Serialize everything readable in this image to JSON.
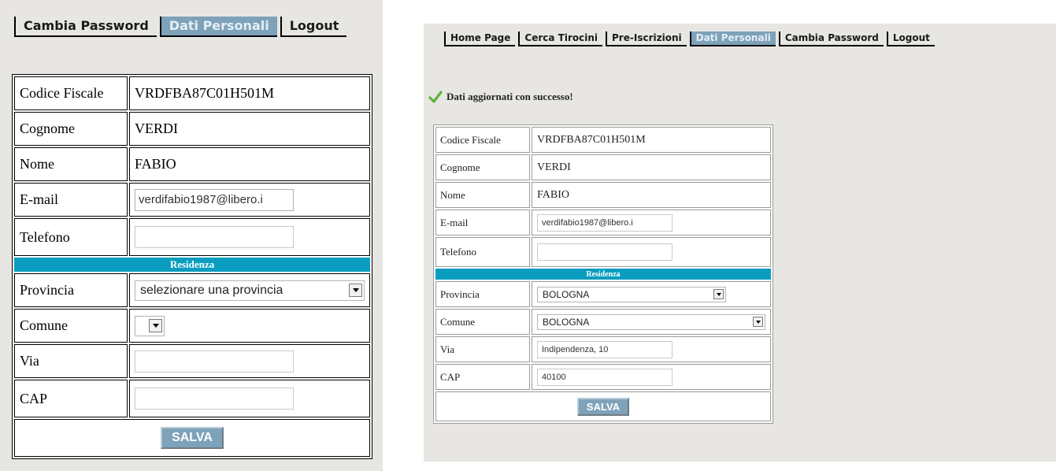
{
  "left": {
    "nav": [
      "Cambia Password",
      "Dati Personali",
      "Logout"
    ],
    "fields": {
      "codice_fiscale": {
        "label": "Codice Fiscale",
        "value": "VRDFBA87C01H501M"
      },
      "cognome": {
        "label": "Cognome",
        "value": "VERDI"
      },
      "nome": {
        "label": "Nome",
        "value": "FABIO"
      },
      "email": {
        "label": "E-mail",
        "value": "verdifabio1987@libero.i"
      },
      "telefono": {
        "label": "Telefono",
        "value": ""
      },
      "section": "Residenza",
      "provincia": {
        "label": "Provincia",
        "value": "selezionare una provincia"
      },
      "comune": {
        "label": "Comune",
        "value": ""
      },
      "via": {
        "label": "Via",
        "value": ""
      },
      "cap": {
        "label": "CAP",
        "value": ""
      }
    },
    "save_label": "SALVA"
  },
  "right": {
    "nav": [
      "Home Page",
      "Cerca Tirocini",
      "Pre-Iscrizioni",
      "Dati Personali",
      "Cambia Password",
      "Logout"
    ],
    "message": "Dati aggiornati con successo!",
    "fields": {
      "codice_fiscale": {
        "label": "Codice Fiscale",
        "value": "VRDFBA87C01H501M"
      },
      "cognome": {
        "label": "Cognome",
        "value": "VERDI"
      },
      "nome": {
        "label": "Nome",
        "value": "FABIO"
      },
      "email": {
        "label": "E-mail",
        "value": "verdifabio1987@libero.i"
      },
      "telefono": {
        "label": "Telefono",
        "value": ""
      },
      "section": "Residenza",
      "provincia": {
        "label": "Provincia",
        "value": "BOLOGNA"
      },
      "comune": {
        "label": "Comune",
        "value": "BOLOGNA"
      },
      "via": {
        "label": "Via",
        "value": "Indipendenza, 10"
      },
      "cap": {
        "label": "CAP",
        "value": "40100"
      }
    },
    "save_label": "SALVA"
  },
  "colors": {
    "active_tab": "#7ea2b9",
    "section_header": "#0a9dc0",
    "success_check": "#5bb535",
    "panel_bg": "#e8e6e3"
  },
  "icons": {
    "success": "check-icon",
    "dropdown": "dropdown-arrow-icon"
  }
}
